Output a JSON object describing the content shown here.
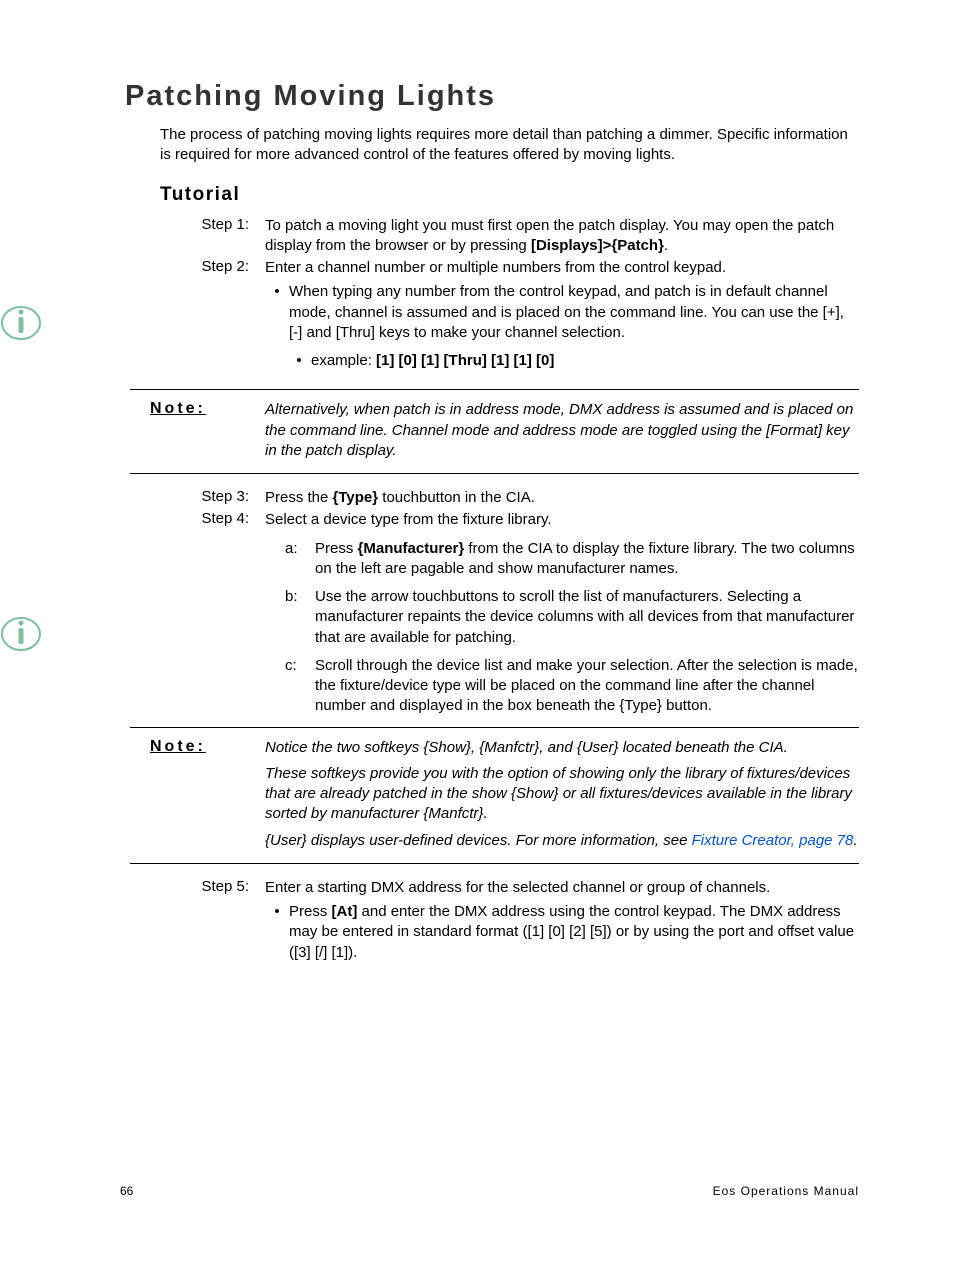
{
  "title": "Patching Moving Lights",
  "intro": "The process of patching moving lights requires more detail than patching a dimmer. Specific information is required for more advanced control of the features offered by moving lights.",
  "tutorial_heading": "Tutorial",
  "step1": {
    "label": "Step 1:",
    "text_a": "To patch a moving light you must first open the patch display. You may open the patch display from the browser or by pressing ",
    "bold_a": "[Displays]>{Patch}",
    "text_b": "."
  },
  "step2": {
    "label": "Step 2:",
    "text": "Enter a channel number or multiple numbers from the control keypad.",
    "bullet1": "When typing any number from the control keypad, and patch is in default channel mode, channel is assumed and is placed on the command line. You can use the [+], [-] and [Thru] keys to make your channel selection.",
    "example_prefix": "example: ",
    "example_bold": "[1] [0] [1] [Thru] [1] [1] [0]"
  },
  "note1": {
    "label": "Note:",
    "text": "Alternatively, when patch is in address mode, DMX address is assumed and is placed on the command line. Channel mode and address mode are toggled using the [Format] key in the patch display."
  },
  "step3": {
    "label": "Step 3:",
    "text_a": "Press the ",
    "bold_a": "{Type}",
    "text_b": " touchbutton in the CIA."
  },
  "step4": {
    "label": "Step 4:",
    "text": "Select a device type from the fixture library.",
    "a": {
      "letter": "a:",
      "prefix": "Press ",
      "bold": "{Manufacturer}",
      "suffix": " from the CIA to display the fixture library. The two columns on the left are pagable and show manufacturer names."
    },
    "b": {
      "letter": "b:",
      "text": "Use the arrow touchbuttons to scroll the list of manufacturers. Selecting a manufacturer repaints the device columns with all devices from that manufacturer that are available for patching."
    },
    "c": {
      "letter": "c:",
      "text": "Scroll through the device list and make your selection. After the selection is made, the fixture/device type will be placed on the command line after the channel number and displayed in the box beneath the {Type} button."
    }
  },
  "note2": {
    "label": "Note:",
    "p1": "Notice the two softkeys {Show}, {Manfctr}, and {User} located beneath the CIA.",
    "p2": "These softkeys provide you with the option of showing only the library of fixtures/devices that are already patched in the show {Show} or all fixtures/devices available in the library sorted by manufacturer {Manfctr}.",
    "p3_a": "{User} displays user-defined devices. For more information, see ",
    "p3_link": "Fixture Creator, page 78",
    "p3_b": "."
  },
  "step5": {
    "label": "Step 5:",
    "text": "Enter a starting DMX address for the selected channel or group of channels.",
    "bullet_a": "Press ",
    "bullet_bold": "[At]",
    "bullet_b": " and enter the DMX address using the control keypad. The DMX address may be entered in standard format ([1] [0] [2] [5]) or by using the port and offset value ([3] [/] [1])."
  },
  "footer": {
    "pagenum": "66",
    "manual": "Eos Operations Manual"
  }
}
